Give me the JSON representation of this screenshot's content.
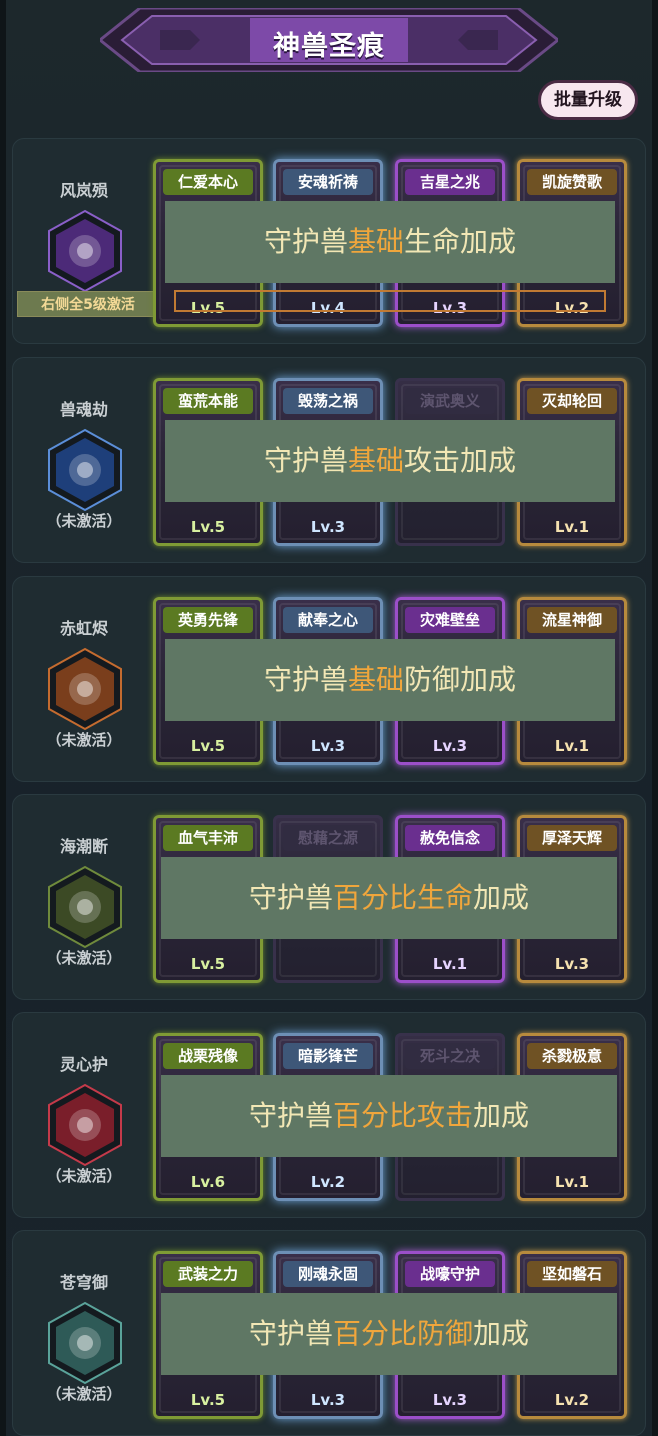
{
  "title": "神兽圣痕",
  "batch_upgrade_label": "批量升级",
  "colors": {
    "overlay_bg": "#5f7764",
    "overlay_text": "#f2e7b5",
    "overlay_highlight": "#f0a63c",
    "highlight_box": "#c17a33"
  },
  "sections": [
    {
      "name": "风岚殒",
      "icon": "demon-skull-icon",
      "status": "右侧全5级激活",
      "overlay": {
        "prefix": "守护兽",
        "highlight": "基础",
        "middle": "生命",
        "suffix": "加成"
      },
      "cards": [
        {
          "title": "仁爱本心",
          "level": "Lv.5",
          "tier": "green"
        },
        {
          "title": "安魂祈祷",
          "level": "Lv.4",
          "tier": "blue"
        },
        {
          "title": "吉星之兆",
          "level": "Lv.3",
          "tier": "purple"
        },
        {
          "title": "凯旋赞歌",
          "level": "Lv.2",
          "tier": "orange"
        }
      ]
    },
    {
      "name": "兽魂劫",
      "icon": "water-drop-icon",
      "status": "（未激活）",
      "overlay": {
        "prefix": "守护兽",
        "highlight": "基础",
        "middle": "攻击",
        "suffix": "加成"
      },
      "cards": [
        {
          "title": "蛮荒本能",
          "level": "Lv.5",
          "tier": "green"
        },
        {
          "title": "毁荡之祸",
          "level": "Lv.3",
          "tier": "blue"
        },
        {
          "title": "演武奥义",
          "level": "",
          "tier": "dim"
        },
        {
          "title": "灭却轮回",
          "level": "Lv.1",
          "tier": "orange"
        }
      ]
    },
    {
      "name": "赤虹烬",
      "icon": "claw-slash-icon",
      "status": "（未激活）",
      "overlay": {
        "prefix": "守护兽",
        "highlight": "基础",
        "middle": "防御",
        "suffix": "加成"
      },
      "cards": [
        {
          "title": "英勇先锋",
          "level": "Lv.5",
          "tier": "green"
        },
        {
          "title": "献奉之心",
          "level": "Lv.3",
          "tier": "blue"
        },
        {
          "title": "灾难壁垒",
          "level": "Lv.3",
          "tier": "purple"
        },
        {
          "title": "流星神御",
          "level": "Lv.1",
          "tier": "orange"
        }
      ]
    },
    {
      "name": "海潮断",
      "icon": "whirlwind-icon",
      "status": "（未激活）",
      "overlay": {
        "prefix": "守护兽",
        "highlight": "百分比",
        "middle": "生命",
        "suffix": "加成"
      },
      "cards": [
        {
          "title": "血气丰沛",
          "level": "Lv.5",
          "tier": "green"
        },
        {
          "title": "慰藉之源",
          "level": "",
          "tier": "dim"
        },
        {
          "title": "赦免信念",
          "level": "Lv.1",
          "tier": "purple"
        },
        {
          "title": "厚泽天辉",
          "level": "Lv.3",
          "tier": "orange"
        }
      ]
    },
    {
      "name": "灵心护",
      "icon": "flame-heart-icon",
      "status": "（未激活）",
      "overlay": {
        "prefix": "守护兽",
        "highlight": "百分比",
        "middle": "攻击",
        "suffix": "加成"
      },
      "cards": [
        {
          "title": "战栗残像",
          "level": "Lv.6",
          "tier": "green"
        },
        {
          "title": "暗影锋芒",
          "level": "Lv.2",
          "tier": "blue"
        },
        {
          "title": "死斗之决",
          "level": "",
          "tier": "dim"
        },
        {
          "title": "杀戮极意",
          "level": "Lv.1",
          "tier": "orange"
        }
      ]
    },
    {
      "name": "苍穹御",
      "icon": "shield-sword-icon",
      "status": "（未激活）",
      "overlay": {
        "prefix": "守护兽",
        "highlight": "百分比",
        "middle": "防御",
        "suffix": "加成"
      },
      "cards": [
        {
          "title": "武装之力",
          "level": "Lv.5",
          "tier": "green"
        },
        {
          "title": "刚魂永固",
          "level": "Lv.3",
          "tier": "blue"
        },
        {
          "title": "战嚎守护",
          "level": "Lv.3",
          "tier": "purple"
        },
        {
          "title": "坚如磐石",
          "level": "Lv.2",
          "tier": "orange"
        }
      ]
    }
  ]
}
